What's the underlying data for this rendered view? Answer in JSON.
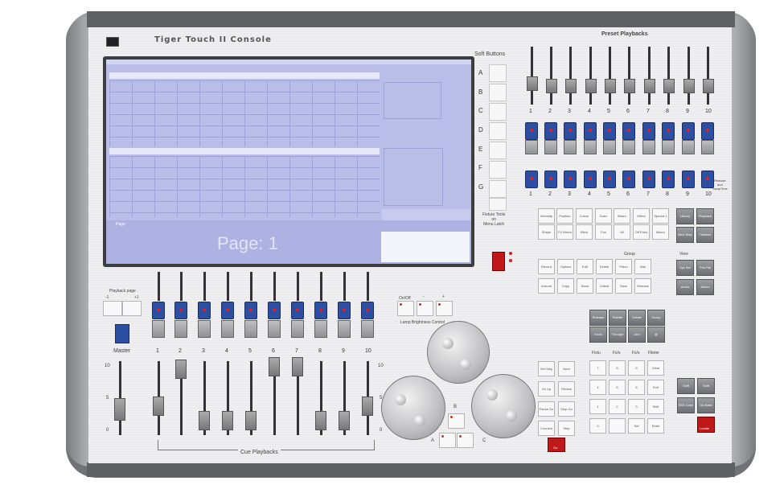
{
  "console": {
    "title": "Tiger Touch II Console",
    "preset_playbacks_label": "Preset Playbacks",
    "soft_buttons_label": "Soft Buttons",
    "soft_buttons": [
      "A",
      "B",
      "C",
      "D",
      "E",
      "F",
      "G"
    ],
    "fixture_tools_label": "Fixture Tools\non\nMenu Latch",
    "playback_page_label": "Playback page",
    "playback_page_minus": "-1",
    "playback_page_plus": "+1",
    "master_label": "Master",
    "cue_playbacks_label": "Cue Playbacks",
    "lamp_label": "Lamp Brightness Control",
    "lamp_onoff": "On/Off",
    "lamp_minus": "-",
    "lamp_plus": "+",
    "wheel_a": "A",
    "wheel_b": "B",
    "wheel_c": "C",
    "screen_page_text": "Page: 1",
    "screen_page_tab": "Page",
    "preset_numbers": [
      "1",
      "2",
      "3",
      "4",
      "5",
      "6",
      "7",
      "8",
      "9",
      "10"
    ],
    "cue_numbers": [
      "1",
      "2",
      "3",
      "4",
      "5",
      "6",
      "7",
      "8",
      "9",
      "10"
    ],
    "scale_top": "10",
    "scale_mid": "5",
    "scale_bottom": "0",
    "release_label": "Release\nand\nSwapTime",
    "attribute_keys": [
      "Intensity",
      "Position",
      "Colour",
      "Gobo",
      "Beam",
      "Effect",
      "Special 1",
      "Shape",
      "FX Mixed",
      "Blind",
      "Fan",
      "All",
      "Off Entry",
      "Macro"
    ],
    "right_top_keys": [
      "Library",
      "Playback",
      "Next\nStep",
      "Timeline"
    ],
    "group_label": "Group",
    "tools_keys": [
      "Record",
      "Options",
      "Edit",
      "Delete",
      "Patch",
      "Disk",
      "Include",
      "Copy",
      "Move",
      "Unfold",
      "Save",
      "Release"
    ],
    "view_label": "View",
    "view_keys": [
      "Sys Set",
      "Pos Pal",
      "Arrow",
      "Macro"
    ],
    "mid_grey_keys": [
      "Release",
      "Palette",
      "Delete",
      "Group",
      "Knob",
      "Through",
      "And",
      "@"
    ],
    "keypad_label_1": "Fixtu",
    "keypad_label_2": "Fx/s",
    "keypad_label_3": "Fx/s",
    "keypad_label_4": "Fileter",
    "left_cue_keys": [
      "Set\nStep",
      "Next",
      "Go\nUp",
      "Review",
      "Pause\nGo",
      "Stop\nGo",
      "Connect",
      "Stop"
    ],
    "keypad_keys": [
      "7",
      "8",
      "9",
      "Clear",
      "4",
      "5",
      "6",
      "Exit",
      "1",
      "2",
      "3",
      "Shift",
      "0",
      ".",
      "Set",
      "Enter"
    ],
    "far_right_keys": [
      "Shift",
      "Shift",
      "SSS\nConn",
      "Go\nBack"
    ],
    "go_label": "Go",
    "locate_label": "Locate",
    "colors": {
      "fader_blue": "#2d4fa3",
      "accent_red": "#c01818",
      "screen": "#b9bde8"
    }
  }
}
